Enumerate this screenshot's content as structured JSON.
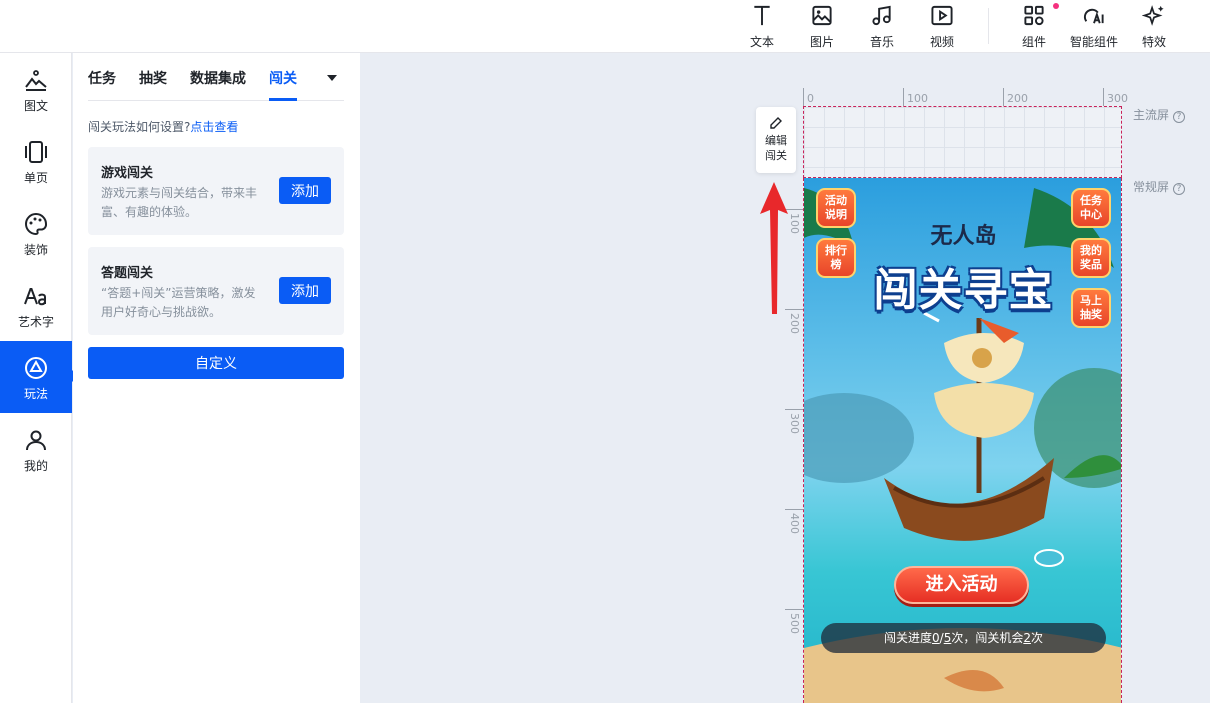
{
  "toolbar": {
    "items": [
      {
        "label": "文本",
        "icon": "text-icon"
      },
      {
        "label": "图片",
        "icon": "image-icon"
      },
      {
        "label": "音乐",
        "icon": "music-icon"
      },
      {
        "label": "视频",
        "icon": "video-icon"
      },
      {
        "label": "组件",
        "icon": "components-icon"
      },
      {
        "label": "智能组件",
        "icon": "ai-components-icon"
      },
      {
        "label": "特效",
        "icon": "effects-icon"
      }
    ]
  },
  "sidebar": {
    "items": [
      {
        "label": "图文",
        "icon": "graphic-text-icon"
      },
      {
        "label": "单页",
        "icon": "single-page-icon"
      },
      {
        "label": "装饰",
        "icon": "palette-icon"
      },
      {
        "label": "艺术字",
        "icon": "art-text-icon"
      },
      {
        "label": "玩法",
        "icon": "gameplay-icon",
        "active": true
      },
      {
        "label": "我的",
        "icon": "user-icon"
      }
    ]
  },
  "panel": {
    "tabs": [
      "任务",
      "抽奖",
      "数据集成",
      "闯关"
    ],
    "active_tab": "闯关",
    "howto_text": "闯关玩法如何设置?",
    "howto_link": "点击查看",
    "cards": [
      {
        "title": "游戏闯关",
        "desc": "游戏元素与闯关结合，带来丰富、有趣的体验。",
        "button": "添加"
      },
      {
        "title": "答题闯关",
        "desc": "“答题+闯关”运营策略，激发用户好奇心与挑战欲。",
        "button": "添加"
      }
    ],
    "custom_button": "自定义"
  },
  "canvas": {
    "ruler_top": [
      "0",
      "100",
      "200",
      "300"
    ],
    "ruler_left": [
      "100",
      "200",
      "300",
      "400",
      "500"
    ],
    "main_screen_label": "主流屏",
    "normal_screen_label": "常规屏",
    "edit_button": {
      "line1": "编辑",
      "line2": "闯关"
    }
  },
  "game": {
    "subtitle": "无人岛",
    "title": "闯关寻宝",
    "left_buttons": [
      {
        "line1": "活动",
        "line2": "说明"
      },
      {
        "line1": "排行",
        "line2": "榜"
      }
    ],
    "right_buttons": [
      {
        "line1": "任务",
        "line2": "中心"
      },
      {
        "line1": "我的",
        "line2": "奖品"
      },
      {
        "line1": "马上",
        "line2": "抽奖"
      }
    ],
    "enter_button": "进入活动",
    "progress": {
      "prefix": "闯关进度",
      "done": "0",
      "sep": "/",
      "total": "5",
      "mid": "次，闯关机会",
      "chances": "2",
      "suffix": "次"
    }
  },
  "colors": {
    "accent": "#0a5cf5",
    "screen_border": "#c8235a",
    "pointer_arrow": "#e8282b"
  }
}
